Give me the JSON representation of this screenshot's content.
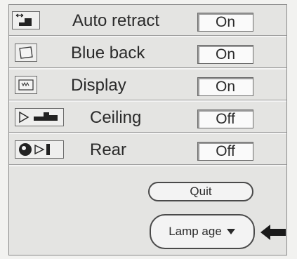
{
  "menu": {
    "items": [
      {
        "label": "Auto retract",
        "value": "On",
        "icon": "auto-retract-icon"
      },
      {
        "label": "Blue back",
        "value": "On",
        "icon": "blue-back-icon"
      },
      {
        "label": "Display",
        "value": "On",
        "icon": "display-icon"
      },
      {
        "label": "Ceiling",
        "value": "Off",
        "icon": "ceiling-icon"
      },
      {
        "label": "Rear",
        "value": "Off",
        "icon": "rear-icon"
      }
    ],
    "quit_label": "Quit",
    "lamp_age_label": "Lamp age"
  }
}
